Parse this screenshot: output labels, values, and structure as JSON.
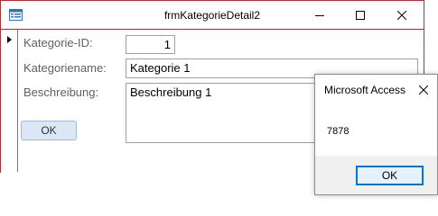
{
  "window": {
    "title": "frmKategorieDetail2",
    "controls": {
      "minimize": "minimize",
      "maximize": "maximize",
      "close": "close"
    }
  },
  "form": {
    "fields": {
      "id_label": "Kategorie-ID:",
      "id_value": "1",
      "name_label": "Kategoriename:",
      "name_value": "Kategorie 1",
      "desc_label": "Beschreibung:",
      "desc_value": "Beschreibung 1"
    },
    "ok_label": "OK"
  },
  "messagebox": {
    "title": "Microsoft Access",
    "text": "7878",
    "ok_label": "OK"
  },
  "colors": {
    "window_border": "#a4373a",
    "focus_blue": "#0078d7"
  },
  "icons": [
    "form-icon",
    "minimize-icon",
    "maximize-icon",
    "close-icon",
    "record-selector-arrow-icon"
  ]
}
